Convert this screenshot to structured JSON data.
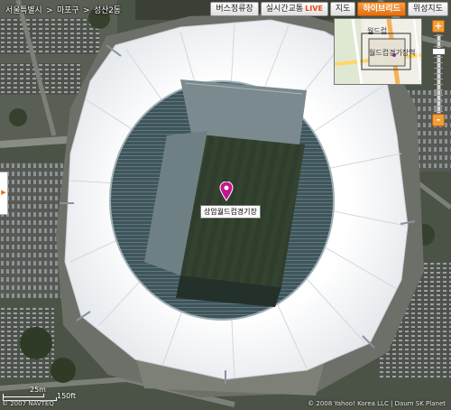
{
  "map": {
    "breadcrumb": [
      "서울특별시",
      ">",
      "마포구",
      ">",
      "성산2동"
    ],
    "toolbar": {
      "bus_stop": "버스정류장",
      "traffic": "실시간교통",
      "traffic_live": "LIVE",
      "map": "지도",
      "hybrid": "하이브리드",
      "satellite": "위성지도"
    },
    "active_view": "hybrid",
    "minimap": {
      "label_top": "월드컵",
      "label_main": "월드컵경기장역"
    },
    "poi": {
      "icon": "map-pin-icon",
      "label": "상암월드컵경기장",
      "pin_color": "#c2168e"
    },
    "zoom": {
      "plus": "+",
      "minus": "-",
      "level_fraction": 0.2
    },
    "scale": {
      "metric": "25m",
      "imperial": "150ft"
    },
    "copyright_left": "© 2007 NAVTEQ",
    "copyright_right": "© 2008 Yahoo! Korea LLC | Daum SK Planet",
    "colors": {
      "accent": "#e26f0e",
      "roof": "#f4f5f7"
    }
  }
}
